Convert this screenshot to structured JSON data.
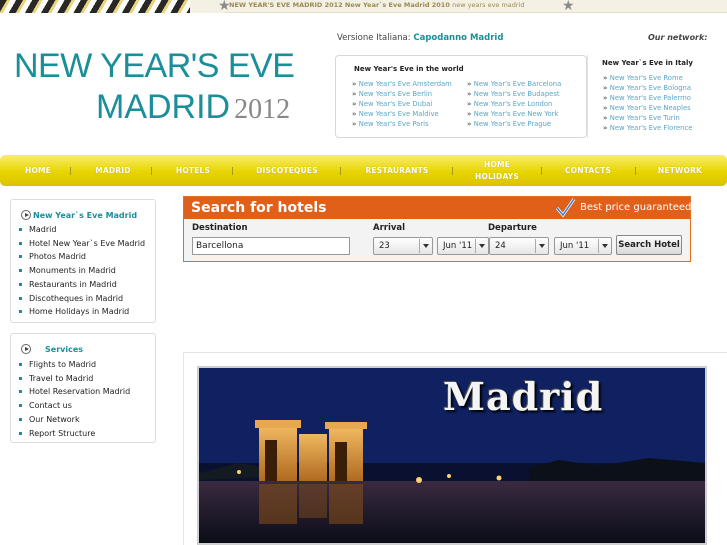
{
  "topbar": {
    "tagline_bold": "NEW YEAR'S EVE MADRID 2012 New Year`s Eve Madrid 2010",
    "tagline_light": "new years eve madrid"
  },
  "logo": {
    "line1": "NEW YEAR'S EVE",
    "line2": "MADRID",
    "year": "2012"
  },
  "header": {
    "versione_label": "Versione Italiana:",
    "versione_link": "Capodanno Madrid",
    "our_network": "Our network:"
  },
  "world_network": {
    "title": "New Year's Eve in the world",
    "col1": [
      "New Year's Eve Amsterdam",
      "New Year's Eve Berlin",
      "New Year's Eve Dubai",
      "New Year's Eve Maldive",
      "New Year's Eve Paris"
    ],
    "col2": [
      "New Year's Eve Barcelona",
      "New Year's Eve Budapest",
      "New Year's Eve London",
      "New Year's Eve New York",
      "New Year's Eve Prague"
    ]
  },
  "italy_network": {
    "title": "New Year`s Eve in Italy",
    "items": [
      "New Year's Eve Rome",
      "New Year's Eve Bologna",
      "New Year's Eve Palermo",
      "New Year's Eve Neaples",
      "New Year's Eve Turin",
      "New Year's Eve Florence"
    ]
  },
  "nav": {
    "items": [
      "HOME",
      "MADRID",
      "HOTELS",
      "DISCOTEQUES",
      "RESTAURANTS",
      "HOME HOLIDAYS",
      "CONTACTS",
      "NETWORK"
    ]
  },
  "sidebar1": {
    "title": "New Year`s Eve Madrid",
    "items": [
      "Madrid",
      "Hotel New Year`s Eve Madrid",
      "Photos Madrid",
      "Monuments in Madrid",
      "Restaurants in Madrid",
      "Discotheques in Madrid",
      "Home Holidays in Madrid"
    ]
  },
  "sidebar2": {
    "title": "Services",
    "items": [
      "Flights to Madrid",
      "Travel to Madrid",
      "Hotel Reservation Madrid",
      "Contact us",
      "Our Network",
      "Report Structure"
    ]
  },
  "search": {
    "title": "Search for hotels",
    "best_price": "Best price guaranteed",
    "destination_label": "Destination",
    "destination_value": "Barcellona",
    "arrival_label": "Arrival",
    "arrival_day": "23",
    "arrival_month": "Jun '11",
    "departure_label": "Departure",
    "departure_day": "24",
    "departure_month": "Jun '11",
    "button": "Search Hotel"
  },
  "photo": {
    "caption": "Madrid"
  },
  "colors": {
    "teal": "#1a8f9a",
    "nav_yellow": "#e8d400",
    "search_orange": "#e0601a",
    "link_blue": "#5aa6c8"
  }
}
